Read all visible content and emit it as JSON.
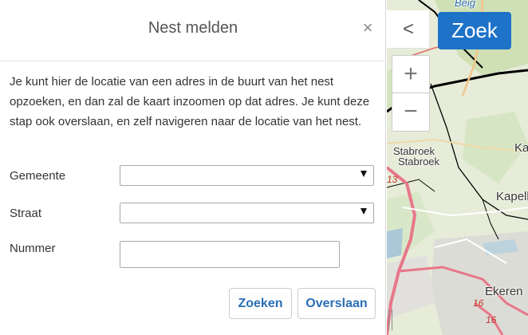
{
  "dialog": {
    "title": "Nest melden",
    "close_symbol": "×",
    "intro": "Je kunt hier de locatie van een adres in de buurt van het nest opzoeken, en dan zal de kaart inzoomen op dat adres. Je kunt deze stap ook overslaan, en zelf navigeren naar de locatie van het nest."
  },
  "form": {
    "gemeente": {
      "label": "Gemeente",
      "value": ""
    },
    "straat": {
      "label": "Straat",
      "value": ""
    },
    "nummer": {
      "label": "Nummer",
      "value": ""
    }
  },
  "buttons": {
    "zoeken": "Zoeken",
    "overslaan": "Overslaan"
  },
  "map": {
    "sidebar_toggle": "<",
    "zoek": "Zoek",
    "zoom_in": "+",
    "zoom_out": "−",
    "labels": {
      "top_partial": "Beig",
      "stabroek_1": "Stabroek",
      "stabroek_2": "Stabroek",
      "ka": "Ka",
      "kapell": "Kapell",
      "ekeren": "Ekeren",
      "road_13": "13",
      "road_16a": "16",
      "road_16b": "16"
    }
  },
  "colors": {
    "accent": "#1e73c8",
    "button_text": "#2a6fb5",
    "map_background": "#e6ecd8",
    "road_pink": "#e8778a",
    "water": "#aac8d8"
  }
}
